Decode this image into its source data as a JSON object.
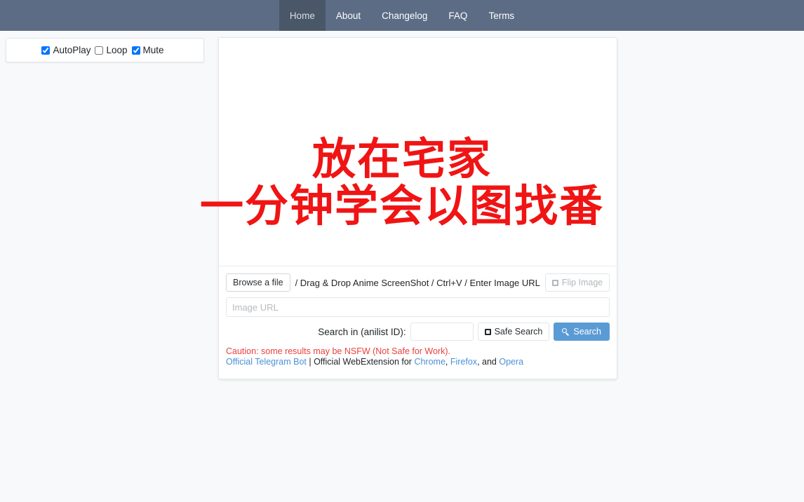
{
  "nav": {
    "items": [
      {
        "label": "Home",
        "active": true
      },
      {
        "label": "About",
        "active": false
      },
      {
        "label": "Changelog",
        "active": false
      },
      {
        "label": "FAQ",
        "active": false
      },
      {
        "label": "Terms",
        "active": false
      }
    ]
  },
  "player_panel": {
    "options": [
      {
        "label": "AutoPlay",
        "checked": true
      },
      {
        "label": "Loop",
        "checked": false
      },
      {
        "label": "Mute",
        "checked": true
      }
    ]
  },
  "media": {
    "caption_line_1": "放在宅家",
    "caption_line_2": "一分钟学会以图找番",
    "caption_color": "#f01414"
  },
  "controls": {
    "browse_label": "Browse a file",
    "hint": "/ Drag & Drop Anime ScreenShot / Ctrl+V / Enter Image URL",
    "flip_label": "Flip Image",
    "url_placeholder": "Image URL",
    "url_value": "",
    "search_in_label": "Search in (anilist ID):",
    "anilist_value": "",
    "anilist_placeholder": "",
    "safe_search_label": "Safe Search",
    "search_label": "Search",
    "search_button_color": "#5b9bd5"
  },
  "footer": {
    "caution": "Caution: some results may be NSFW (Not Safe for Work).",
    "caution_color": "#e8413a",
    "telegram_link": "Official Telegram Bot",
    "separator": " | ",
    "webext_text": "Official WebExtension for ",
    "chrome_link": "Chrome",
    "comma_1": ", ",
    "firefox_link": "Firefox",
    "comma_2": ", and ",
    "opera_link": "Opera",
    "link_color": "#4a90d9"
  }
}
